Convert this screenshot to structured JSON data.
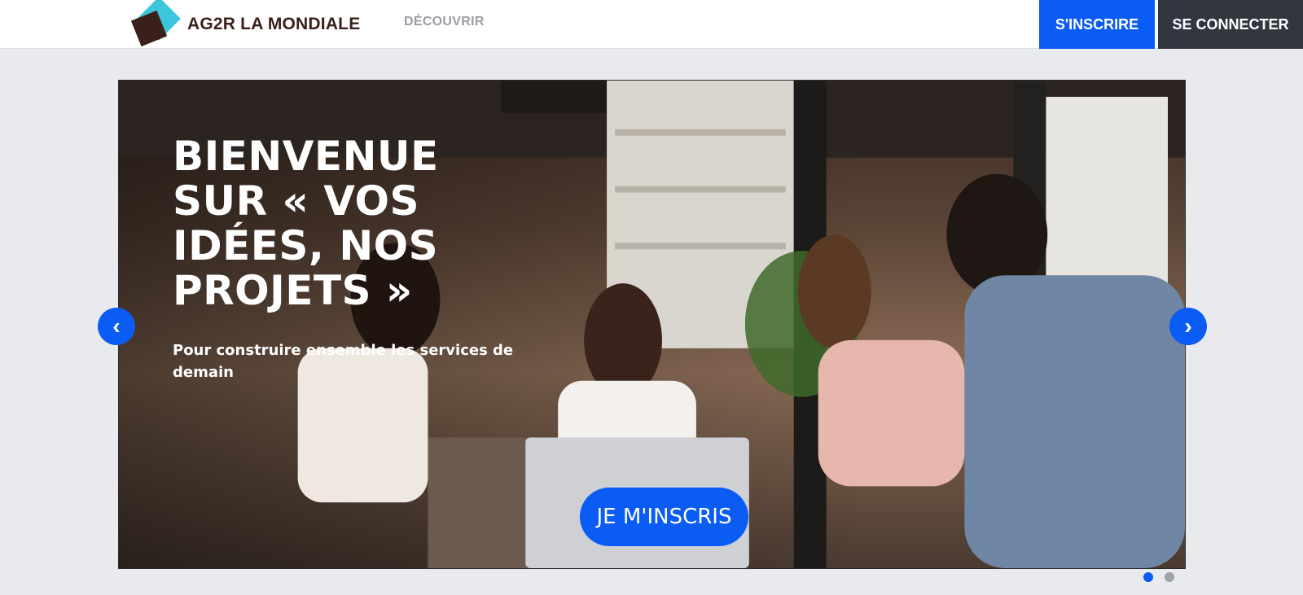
{
  "header": {
    "logo_text": "AG2R LA MONDIALE",
    "nav_discover": "DÉCOUVRIR",
    "signup_label": "S'INSCRIRE",
    "login_label": "SE CONNECTER"
  },
  "hero": {
    "title": "BIENVENUE SUR « VOS IDÉES, NOS PROJETS »",
    "subtitle": "Pour construire ensemble les services de demain",
    "cta_label": "JE M'INSCRIS"
  },
  "carousel": {
    "prev_icon": "chevron-left-icon",
    "next_icon": "chevron-right-icon",
    "slide_count": 2,
    "active_slide": 1
  },
  "colors": {
    "accent": "#0a5cf5",
    "dark_button": "#33363f",
    "page_bg": "#e8eaee",
    "logo_cyan": "#3cc6dc",
    "logo_brown": "#3a1f1a"
  }
}
